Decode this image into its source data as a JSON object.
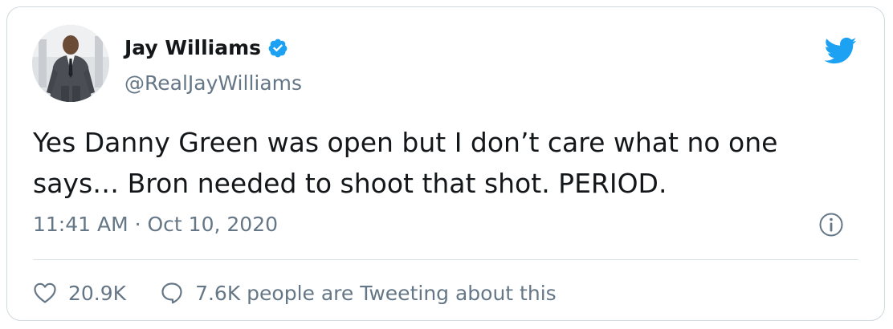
{
  "author": {
    "name": "Jay Williams",
    "handle": "@RealJayWilliams",
    "verified": true,
    "avatar_icon": "profile-photo-man-in-suit"
  },
  "tweet": {
    "text": "Yes Danny Green was open but I don’t care what no one\nsays… Bron needed to shoot that shot. PERIOD.",
    "timestamp": "11:41 AM · Oct 10, 2020"
  },
  "stats": {
    "likes": "20.9K",
    "conversation": "7.6K people are Tweeting about this"
  },
  "icons": {
    "brand": "twitter-bird-icon",
    "verified": "verified-badge-icon",
    "info": "info-icon",
    "like": "heart-icon",
    "reply": "speech-bubble-icon"
  },
  "colors": {
    "brand_blue": "#1da1f2",
    "text_primary": "#14171a",
    "text_secondary": "#657786",
    "border": "#cfd9de"
  }
}
